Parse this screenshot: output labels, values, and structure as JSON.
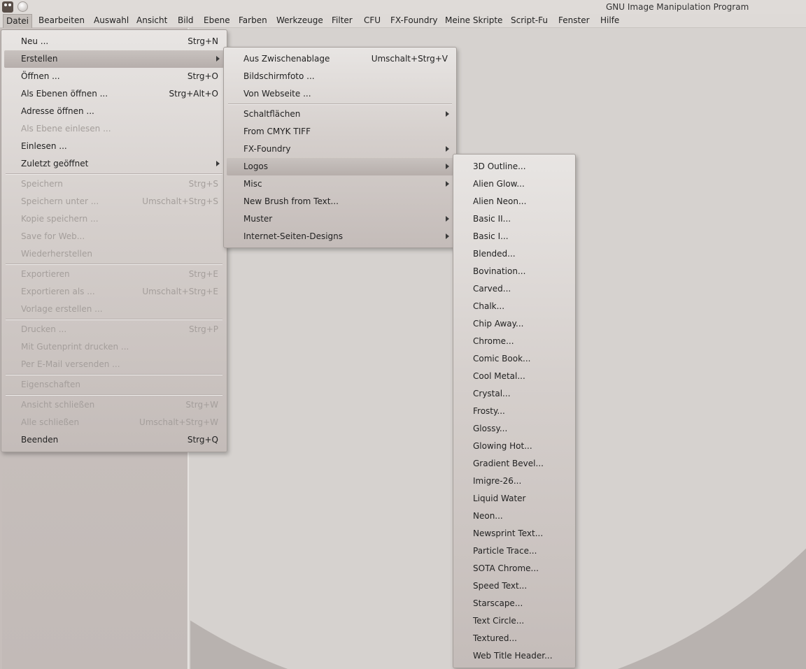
{
  "window": {
    "title": "GNU Image Manipulation Program",
    "icon": "gimp-app-icon"
  },
  "menubar": [
    "Datei",
    "Bearbeiten",
    "Auswahl",
    "Ansicht",
    "Bild",
    "Ebene",
    "Farben",
    "Werkzeuge",
    "Filter",
    "CFU",
    "FX-Foundry",
    "Meine Skripte",
    "Script-Fu",
    "Fenster",
    "Hilfe"
  ],
  "file_menu": [
    {
      "label": "Neu ...",
      "accel": "Strg+N",
      "disabled": false
    },
    {
      "label": "Erstellen",
      "accel": "",
      "disabled": false,
      "submenu": true,
      "highlighted": true
    },
    {
      "label": "Öffnen ...",
      "accel": "Strg+O",
      "disabled": false
    },
    {
      "label": "Als Ebenen öffnen ...",
      "accel": "Strg+Alt+O",
      "disabled": false
    },
    {
      "label": "Adresse öffnen ...",
      "accel": "",
      "disabled": false
    },
    {
      "label": "Als Ebene einlesen ...",
      "accel": "",
      "disabled": true
    },
    {
      "label": "Einlesen ...",
      "accel": "",
      "disabled": false
    },
    {
      "label": "Zuletzt geöffnet",
      "accel": "",
      "disabled": false,
      "submenu": true
    },
    {
      "label": "Speichern",
      "accel": "Strg+S",
      "disabled": true
    },
    {
      "label": "Speichern unter ...",
      "accel": "Umschalt+Strg+S",
      "disabled": true
    },
    {
      "label": "Kopie speichern ...",
      "accel": "",
      "disabled": true
    },
    {
      "label": "Save for Web...",
      "accel": "",
      "disabled": true
    },
    {
      "label": "Wiederherstellen",
      "accel": "",
      "disabled": true
    },
    {
      "label": "Exportieren",
      "accel": "Strg+E",
      "disabled": true
    },
    {
      "label": "Exportieren als ...",
      "accel": "Umschalt+Strg+E",
      "disabled": true
    },
    {
      "label": "Vorlage erstellen ...",
      "accel": "",
      "disabled": true
    },
    {
      "label": "Drucken ...",
      "accel": "Strg+P",
      "disabled": true
    },
    {
      "label": "Mit Gutenprint drucken ...",
      "accel": "",
      "disabled": true
    },
    {
      "label": "Per E-Mail versenden ...",
      "accel": "",
      "disabled": true
    },
    {
      "label": "Eigenschaften",
      "accel": "",
      "disabled": true
    },
    {
      "label": "Ansicht schließen",
      "accel": "Strg+W",
      "disabled": true
    },
    {
      "label": "Alle schließen",
      "accel": "Umschalt+Strg+W",
      "disabled": true
    },
    {
      "label": "Beenden",
      "accel": "Strg+Q",
      "disabled": false
    }
  ],
  "create_menu": [
    {
      "label": "Aus Zwischenablage",
      "accel": "Umschalt+Strg+V"
    },
    {
      "label": "Bildschirmfoto ...",
      "accel": ""
    },
    {
      "label": "Von Webseite ...",
      "accel": ""
    },
    {
      "label": "Schaltflächen",
      "accel": "",
      "submenu": true
    },
    {
      "label": "From CMYK TIFF",
      "accel": ""
    },
    {
      "label": "FX-Foundry",
      "accel": "",
      "submenu": true
    },
    {
      "label": "Logos",
      "accel": "",
      "submenu": true,
      "highlighted": true
    },
    {
      "label": "Misc",
      "accel": "",
      "submenu": true
    },
    {
      "label": "New Brush from Text...",
      "accel": ""
    },
    {
      "label": "Muster",
      "accel": "",
      "submenu": true
    },
    {
      "label": "Internet-Seiten-Designs",
      "accel": "",
      "submenu": true
    }
  ],
  "logos_menu": [
    "3D Outline...",
    "Alien Glow...",
    "Alien Neon...",
    "Basic II...",
    "Basic I...",
    "Blended...",
    "Bovination...",
    "Carved...",
    "Chalk...",
    "Chip Away...",
    "Chrome...",
    "Comic Book...",
    "Cool Metal...",
    "Crystal...",
    "Frosty...",
    "Glossy...",
    "Glowing Hot...",
    "Gradient Bevel...",
    "Imigre-26...",
    "Liquid Water",
    "Neon...",
    "Newsprint Text...",
    "Particle Trace...",
    "SOTA Chrome...",
    "Speed Text...",
    "Starscape...",
    "Text Circle...",
    "Textured...",
    "Web Title Header..."
  ]
}
